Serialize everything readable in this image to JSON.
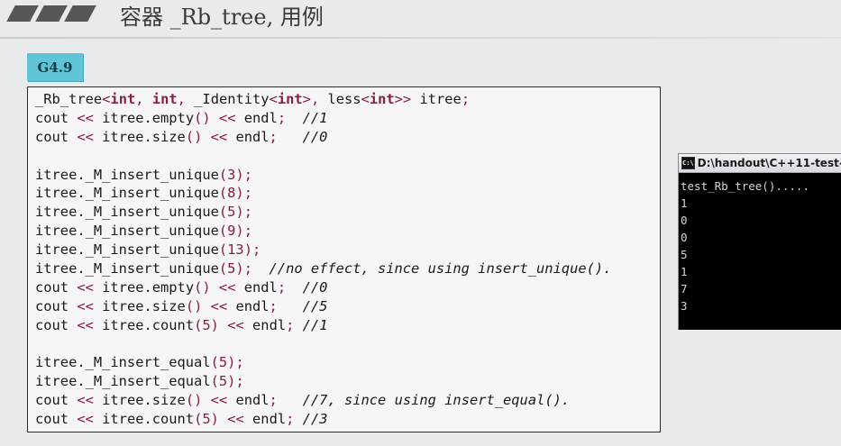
{
  "slide": {
    "title": "容器 _Rb_tree, 用例",
    "badge": "G4.9"
  },
  "code_lines": [
    "_Rb_tree<int, int, _Identity<int>, less<int>> itree;",
    "cout << itree.empty() << endl;  //1",
    "cout << itree.size() << endl;   //0",
    "",
    "itree._M_insert_unique(3);",
    "itree._M_insert_unique(8);",
    "itree._M_insert_unique(5);",
    "itree._M_insert_unique(9);",
    "itree._M_insert_unique(13);",
    "itree._M_insert_unique(5);  //no effect, since using insert_unique().",
    "cout << itree.empty() << endl;  //0",
    "cout << itree.size() << endl;   //5",
    "cout << itree.count(5) << endl; //1",
    "",
    "itree._M_insert_equal(5);",
    "itree._M_insert_equal(5);",
    "cout << itree.size() << endl;   //7, since using insert_equal().",
    "cout << itree.count(5) << endl; //3"
  ],
  "console": {
    "icon": "C:\\",
    "title": "D:\\handout\\C++11-test-",
    "lines": [
      "test_Rb_tree().....",
      "1",
      "0",
      "0",
      "5",
      "1",
      "7",
      "3"
    ]
  }
}
